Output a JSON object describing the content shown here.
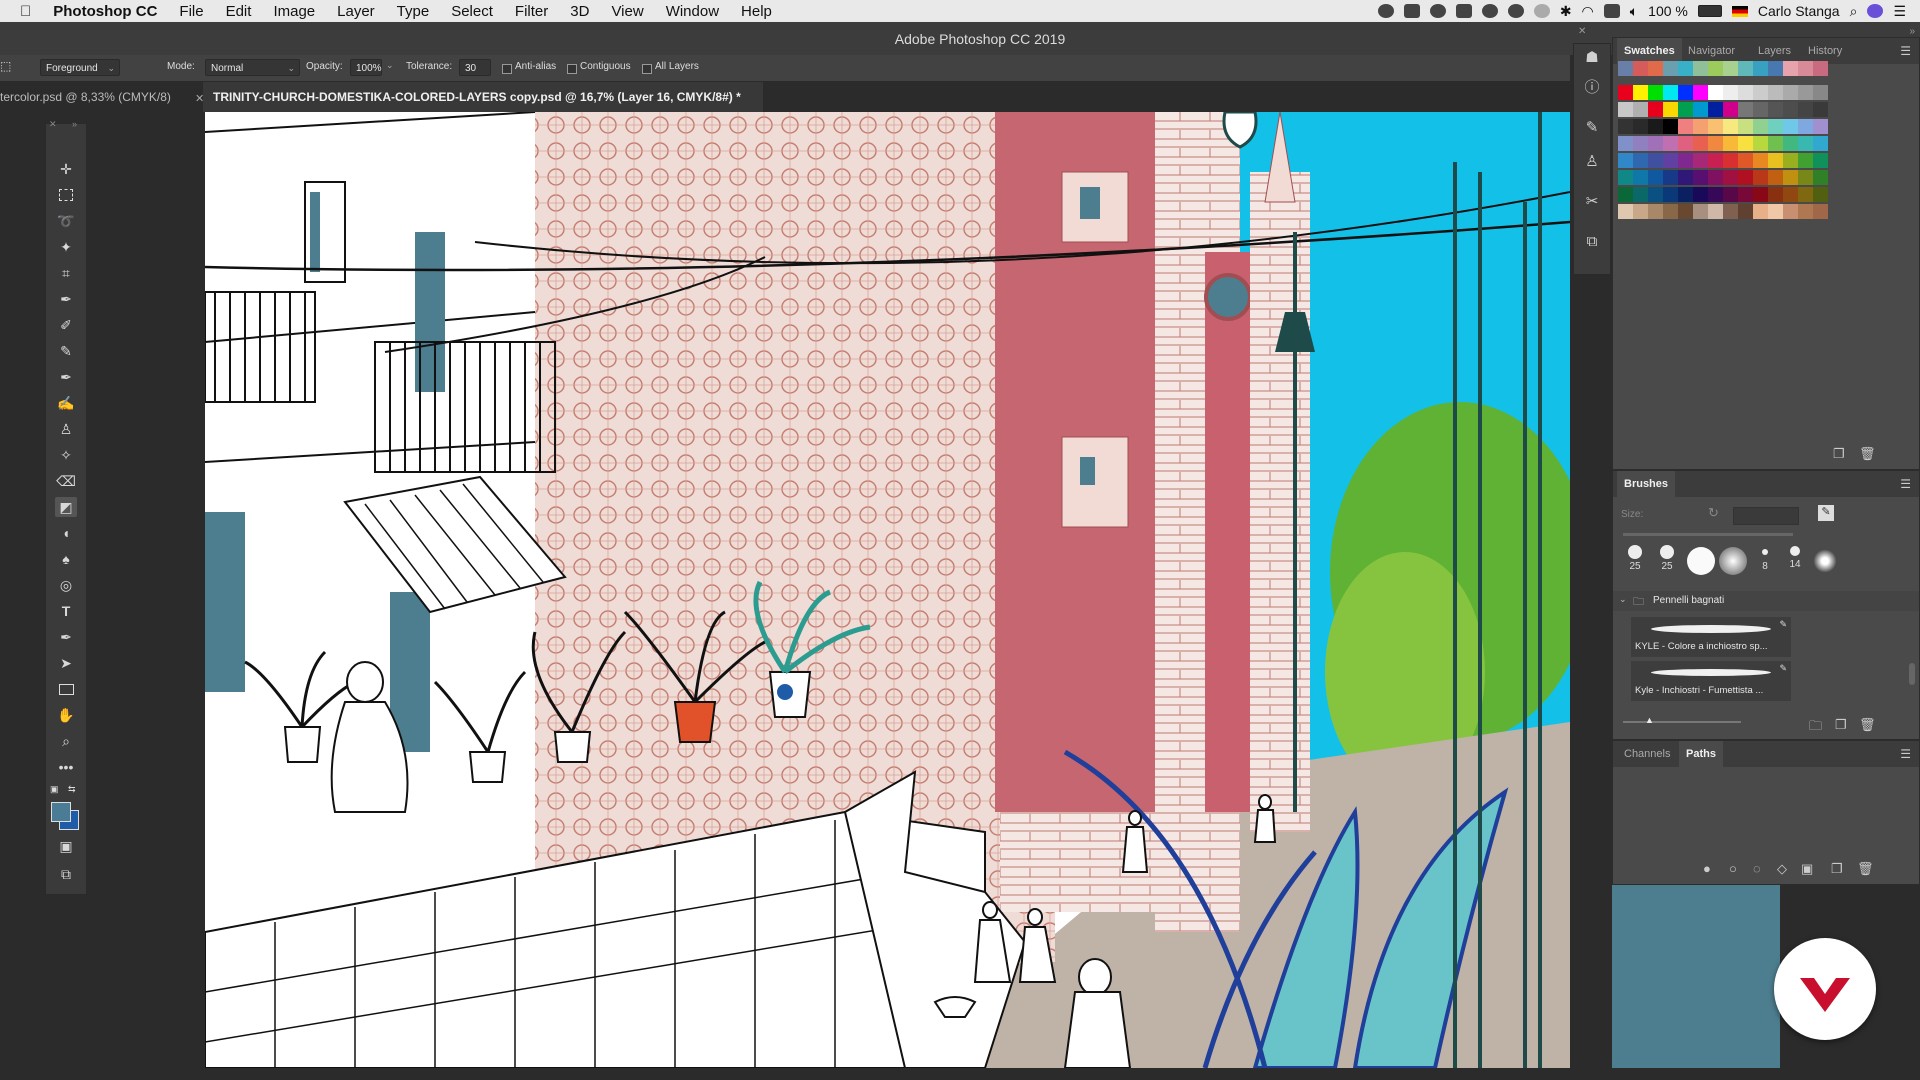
{
  "menubar": {
    "app_name": "Photoshop CC",
    "items": [
      "File",
      "Edit",
      "Image",
      "Layer",
      "Type",
      "Select",
      "Filter",
      "3D",
      "View",
      "Window",
      "Help"
    ],
    "battery": "100 %",
    "user": "Carlo Stanga"
  },
  "window": {
    "title": "Adobe Photoshop CC 2019"
  },
  "options": {
    "tool_preset": "Foreground",
    "mode_label": "Mode:",
    "mode_value": "Normal",
    "opacity_label": "Opacity:",
    "opacity_value": "100%",
    "tolerance_label": "Tolerance:",
    "tolerance_value": "30",
    "anti_alias": "Anti-alias",
    "contiguous": "Contiguous",
    "all_layers": "All Layers"
  },
  "tabs": [
    {
      "label": "tercolor.psd @ 8,33% (CMYK/8)"
    },
    {
      "label": "TRINITY-CHURCH-DOMESTIKA-COLORED-LAYERS copy.psd @ 16,7% (Layer 16, CMYK/8#) *"
    }
  ],
  "panels": {
    "swatches_tabs": [
      "Swatches",
      "Navigator",
      "Layers",
      "History"
    ],
    "brushes": {
      "title": "Brushes",
      "size_label": "Size:",
      "preset_sizes": [
        "25",
        "25",
        "",
        "",
        "8",
        "14",
        ""
      ],
      "group": "Pennelli bagnati",
      "items": [
        "KYLE - Colore a inchiostro sp...",
        "Kyle - Inchiostri - Fumettista ..."
      ]
    },
    "channels_tabs": [
      "Channels",
      "Paths"
    ]
  },
  "colors": {
    "foreground": "#4a7d95",
    "background": "#1f5ca8",
    "accent_red": "#c8102e"
  }
}
